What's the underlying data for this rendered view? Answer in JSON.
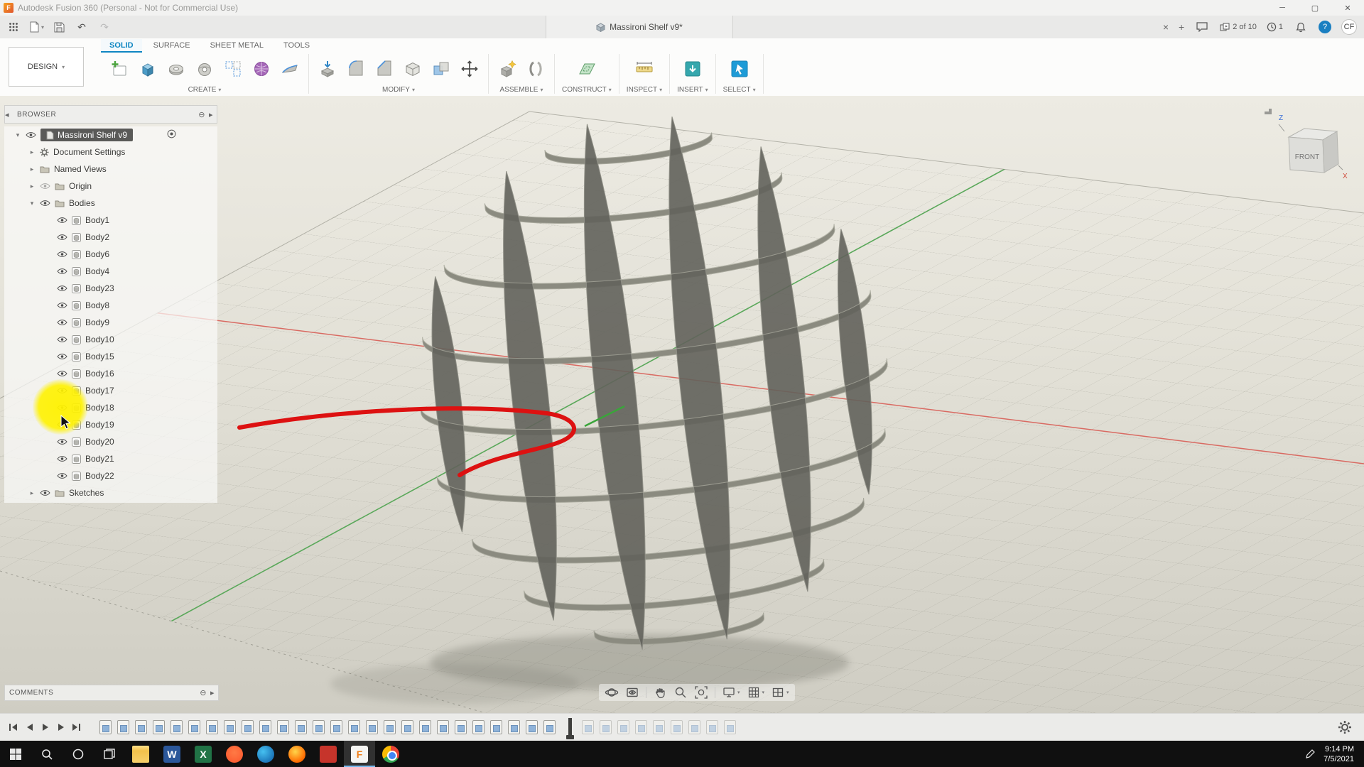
{
  "title_bar": {
    "app_title": "Autodesk Fusion 360 (Personal - Not for Commercial Use)"
  },
  "tab_bar": {
    "document_tab": "Massironi Shelf v9*",
    "job_status": "2 of 10",
    "notification_count": "1",
    "help_label": "?",
    "avatar_initials": "CF"
  },
  "ribbon": {
    "design_label": "DESIGN",
    "tabs": [
      {
        "label": "SOLID",
        "active": true
      },
      {
        "label": "SURFACE"
      },
      {
        "label": "SHEET METAL"
      },
      {
        "label": "TOOLS"
      }
    ],
    "group_labels": [
      "CREATE",
      "MODIFY",
      "ASSEMBLE",
      "CONSTRUCT",
      "INSPECT",
      "INSERT",
      "SELECT"
    ]
  },
  "browser": {
    "header": "BROWSER",
    "root_label": "Massironi Shelf v9",
    "doc_settings_label": "Document Settings",
    "named_views_label": "Named Views",
    "origin_label": "Origin",
    "bodies_label": "Bodies",
    "bodies": [
      "Body1",
      "Body2",
      "Body6",
      "Body4",
      "Body23",
      "Body8",
      "Body9",
      "Body10",
      "Body15",
      "Body16",
      "Body17",
      "Body18",
      "Body19",
      "Body20",
      "Body21",
      "Body22"
    ],
    "sketches_label": "Sketches"
  },
  "comments": {
    "label": "COMMENTS"
  },
  "viewcube": {
    "front": "FRONT",
    "x": "X",
    "z": "Z"
  },
  "timeline": {
    "done_count": 26,
    "pending_count": 9
  },
  "taskbar": {
    "time": "9:14 PM",
    "date": "7/5/2021",
    "apps": [
      {
        "name": "file-explorer",
        "letter": ""
      },
      {
        "name": "word",
        "letter": "W"
      },
      {
        "name": "excel",
        "letter": "X"
      },
      {
        "name": "brave",
        "letter": ""
      },
      {
        "name": "edge",
        "letter": ""
      },
      {
        "name": "firefox",
        "letter": ""
      },
      {
        "name": "red-app",
        "letter": ""
      },
      {
        "name": "fusion-360",
        "letter": "F",
        "active": true
      },
      {
        "name": "chrome",
        "letter": ""
      }
    ]
  },
  "colors": {
    "accent": "#0f86c2",
    "highlight": "#fff200",
    "annotation": "#dd1111"
  }
}
